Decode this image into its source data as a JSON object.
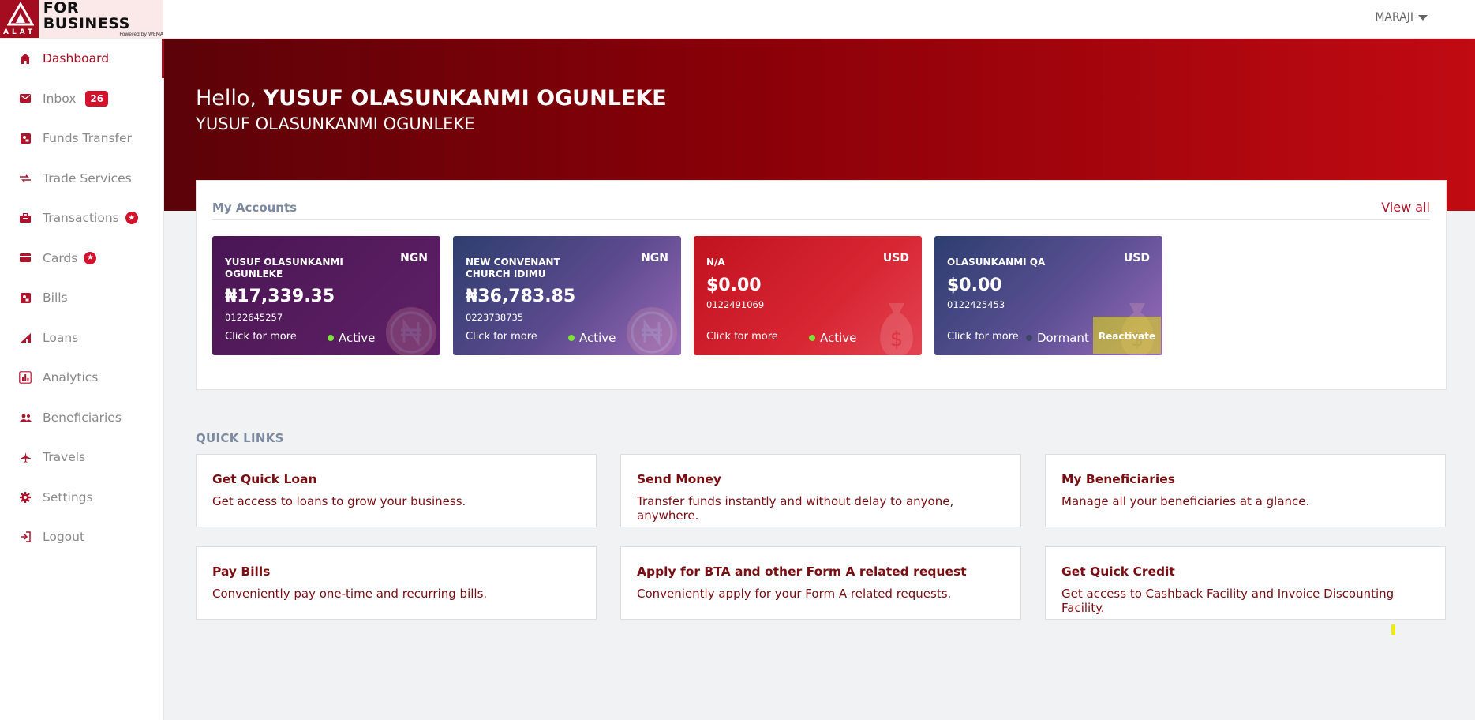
{
  "brand": {
    "logo_text": "FOR BUSINESS",
    "logo_sub": "Powered by WEMA",
    "logo_mark": "ALAT"
  },
  "user_menu": {
    "label": "MARAJI"
  },
  "sidebar": {
    "items": [
      {
        "label": "Dashboard",
        "icon": "home-icon",
        "active": true
      },
      {
        "label": "Inbox",
        "icon": "mail-icon",
        "badge": "26"
      },
      {
        "label": "Funds Transfer",
        "icon": "transfer-icon"
      },
      {
        "label": "Trade Services",
        "icon": "exchange-icon"
      },
      {
        "label": "Transactions",
        "icon": "briefcase-icon",
        "dot": "★"
      },
      {
        "label": "Cards",
        "icon": "card-icon",
        "dot": "★"
      },
      {
        "label": "Bills",
        "icon": "bill-icon"
      },
      {
        "label": "Loans",
        "icon": "loan-icon"
      },
      {
        "label": "Analytics",
        "icon": "analytics-icon"
      },
      {
        "label": "Beneficiaries",
        "icon": "people-icon"
      },
      {
        "label": "Travels",
        "icon": "plane-icon"
      },
      {
        "label": "Settings",
        "icon": "gear-icon"
      },
      {
        "label": "Logout",
        "icon": "logout-icon"
      }
    ]
  },
  "hero": {
    "greeting": "Hello,",
    "name": "YUSUF OLASUNKANMI OGUNLEKE",
    "subtitle": "YUSUF OLASUNKANMI OGUNLEKE"
  },
  "accounts": {
    "title": "My Accounts",
    "view_all": "View all",
    "cards": [
      {
        "name": "YUSUF OLASUNKANMI OGUNLEKE",
        "currency": "NGN",
        "balance": "₦17,339.35",
        "number": "0122645257",
        "more": "Click for more",
        "status": "Active"
      },
      {
        "name": "NEW CONVENANT CHURCH IDIMU",
        "currency": "NGN",
        "balance": "₦36,783.85",
        "number": "0223738735",
        "more": "Click for more",
        "status": "Active"
      },
      {
        "name": "N/A",
        "currency": "USD",
        "balance": "$0.00",
        "number": "0122491069",
        "more": "Click for more",
        "status": "Active"
      },
      {
        "name": "OLASUNKANMI QA",
        "currency": "USD",
        "balance": "$0.00",
        "number": "0122425453",
        "more": "Click for more",
        "status": "Dormant",
        "action": "Reactivate"
      }
    ]
  },
  "quick_links": {
    "title": "QUICK LINKS",
    "items": [
      {
        "title": "Get Quick Loan",
        "desc": "Get access to loans to grow your business."
      },
      {
        "title": "Send Money",
        "desc": "Transfer funds instantly and without delay to anyone, anywhere."
      },
      {
        "title": "My Beneficiaries",
        "desc": "Manage all your beneficiaries at a glance."
      },
      {
        "title": "Pay Bills",
        "desc": "Conveniently pay one-time and recurring bills."
      },
      {
        "title": "Apply for BTA and other Form A related request",
        "desc": "Conveniently apply for your Form A related requests."
      },
      {
        "title": "Get Quick Credit",
        "desc": "Get access to Cashback Facility and Invoice Discounting Facility."
      }
    ]
  },
  "colors": {
    "brand_red": "#a30d1f",
    "hero_dark": "#5b0208",
    "hero_light": "#c10a12",
    "link_red": "#7a0d12",
    "active_green": "#7ee23a"
  }
}
